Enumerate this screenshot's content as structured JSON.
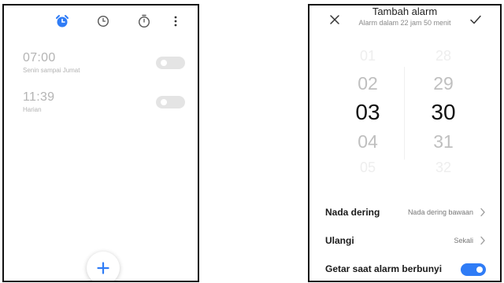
{
  "colors": {
    "accent": "#2f7cf6",
    "inactive_text": "#b4b4b4",
    "toggle_off": "#e4e4e4",
    "panel_border": "#111111"
  },
  "alarm_list": {
    "tabs": [
      {
        "icon": "alarm-clock-icon",
        "active": true
      },
      {
        "icon": "clock-icon",
        "active": false
      },
      {
        "icon": "stopwatch-icon",
        "active": false
      }
    ],
    "menu_icon": "more-vertical-icon",
    "alarms": [
      {
        "time": "07:00",
        "repeat": "Senin sampai Jumat",
        "enabled": false
      },
      {
        "time": "11:39",
        "repeat": "Harian",
        "enabled": false
      }
    ],
    "fab_icon": "plus-icon"
  },
  "add_alarm": {
    "title": "Tambah alarm",
    "subtitle": "Alarm dalam 22 jam 50 menit",
    "close_icon": "close-icon",
    "confirm_icon": "check-icon",
    "hours": [
      "01",
      "02",
      "03",
      "04",
      "05"
    ],
    "minutes": [
      "28",
      "29",
      "30",
      "31",
      "32"
    ],
    "selected_hour": "03",
    "selected_minute": "30",
    "settings": {
      "ringtone": {
        "label": "Nada dering",
        "value": "Nada dering bawaan"
      },
      "repeat": {
        "label": "Ulangi",
        "value": "Sekali"
      },
      "vibrate": {
        "label": "Getar saat alarm berbunyi",
        "enabled": true
      }
    }
  }
}
